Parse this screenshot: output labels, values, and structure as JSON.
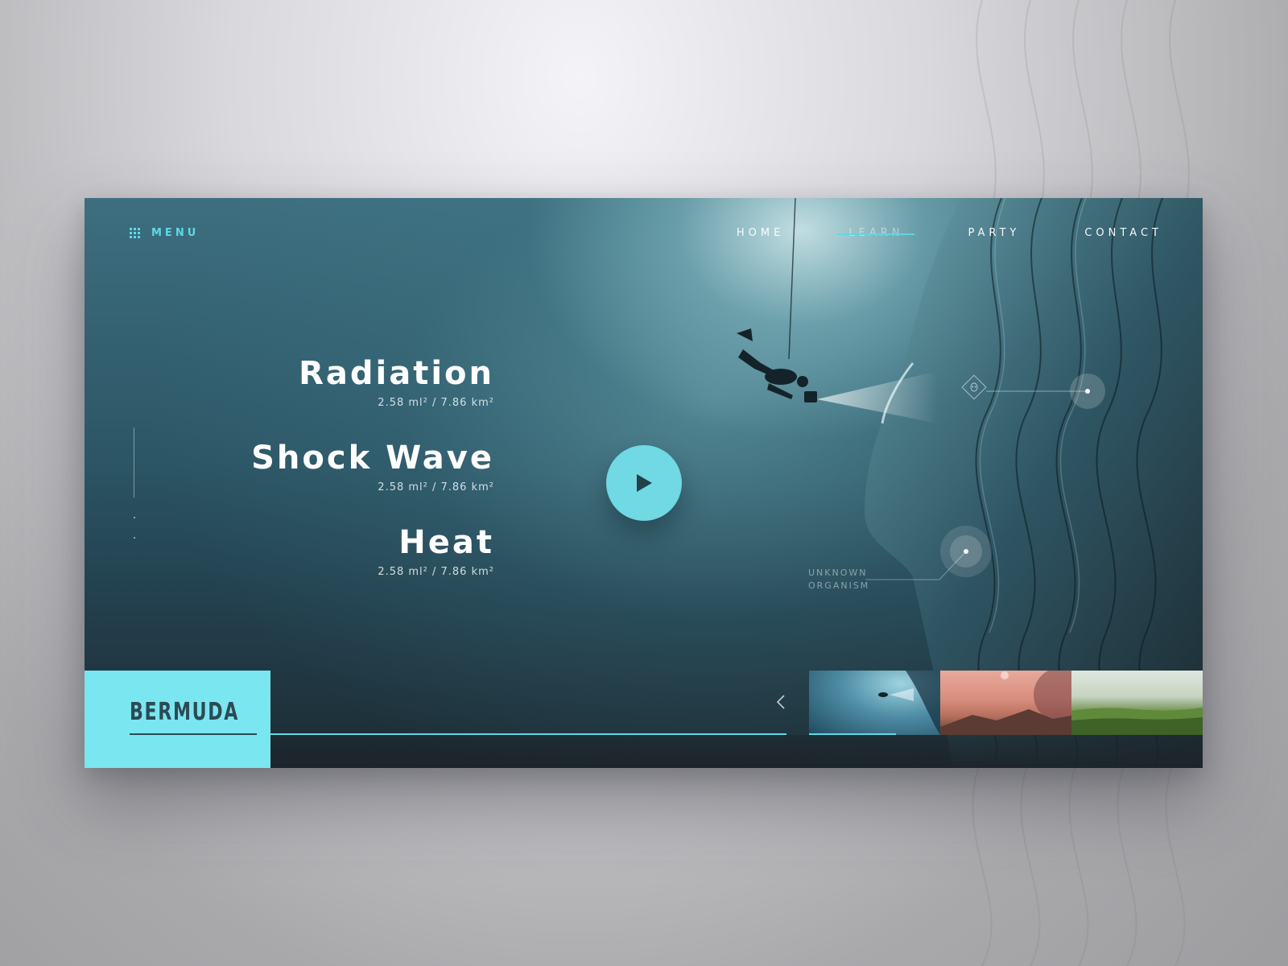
{
  "header": {
    "menu_label": "MENU",
    "nav": [
      {
        "label": "HOME",
        "active": false
      },
      {
        "label": "LEARN",
        "active": true
      },
      {
        "label": "PARTY",
        "active": false
      },
      {
        "label": "CONTACT",
        "active": false
      }
    ]
  },
  "facts": [
    {
      "title": "Radiation",
      "metric": "2.58 ml² / 7.86 km²"
    },
    {
      "title": "Shock Wave",
      "metric": "2.58 ml² / 7.86 km²"
    },
    {
      "title": "Heat",
      "metric": "2.58 ml² / 7.86 km²"
    }
  ],
  "hotspots": {
    "organism_label_line1": "UNKNOWN",
    "organism_label_line2": "ORGANISM"
  },
  "footer": {
    "brand": "BERMUDA",
    "slider_progress": 1.0,
    "thumbnail_progress": 0.22
  },
  "colors": {
    "accent": "#5fd8e6",
    "brand_box": "#7ae6f0",
    "brand_text": "#2c4a55",
    "play_button": "#70d9e3"
  },
  "icons": {
    "menu": "grid-icon",
    "play": "play-icon",
    "prev": "chevron-left-icon",
    "alien": "alien-icon"
  }
}
